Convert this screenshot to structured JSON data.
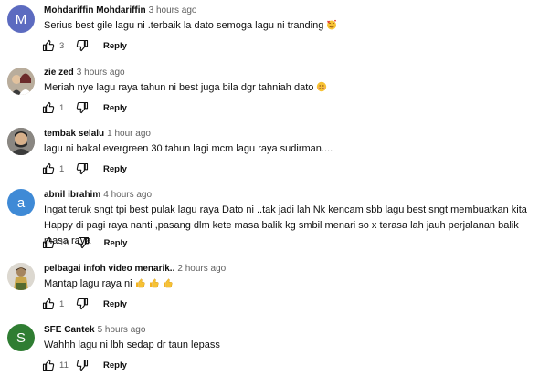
{
  "reply_label": "Reply",
  "comments": [
    {
      "avatar_letter": "M",
      "avatar_color": "#5c6bc0",
      "author": "Mohdariffin Mohdariffin",
      "time": "3 hours ago",
      "text": "Serius best gile lagu ni  .terbaik la dato semoga lagu ni tranding",
      "trailing_emoji": "smiling-face-with-hearts",
      "likes": "3"
    },
    {
      "avatar_letter": "",
      "avatar_color": "#c4b7a6",
      "author": "zie zed",
      "time": "3 hours ago",
      "text": "Meriah nye lagu raya tahun ni  best  juga bila  dgr  tahniah  dato",
      "trailing_emoji": "smiling-face",
      "likes": "1"
    },
    {
      "avatar_letter": "",
      "avatar_color": "#6d6a66",
      "author": "tembak selalu",
      "time": "1 hour ago",
      "text": "lagu ni bakal evergreen 30 tahun lagi mcm lagu raya sudirman....",
      "likes": "1"
    },
    {
      "avatar_letter": "a",
      "avatar_color": "#3f8ad6",
      "author": "abnil ibrahim",
      "time": "4 hours ago",
      "text": "Ingat teruk sngt tpi  best pulak lagu raya Dato ni ..tak jadi lah Nk kencam sbb lagu best sngt membuatkan kita Happy di pagi raya nanti ,pasang dlm kete masa balik kg smbil menari so x terasa lah jauh perjalanan balik masa raya",
      "likes": "19"
    },
    {
      "avatar_letter": "",
      "avatar_color": "#d8d4cc",
      "author": "pelbagai infoh video menarik..",
      "time": "2 hours ago",
      "text": "Mantap lagu raya ni",
      "trailing_emoji": "thumbs-up x3",
      "likes": "1"
    },
    {
      "avatar_letter": "S",
      "avatar_color": "#2f7d32",
      "author": "SFE Cantek",
      "time": "5 hours ago",
      "text": "Wahhh lagu ni lbh sedap dr taun lepass",
      "likes": "11"
    }
  ]
}
